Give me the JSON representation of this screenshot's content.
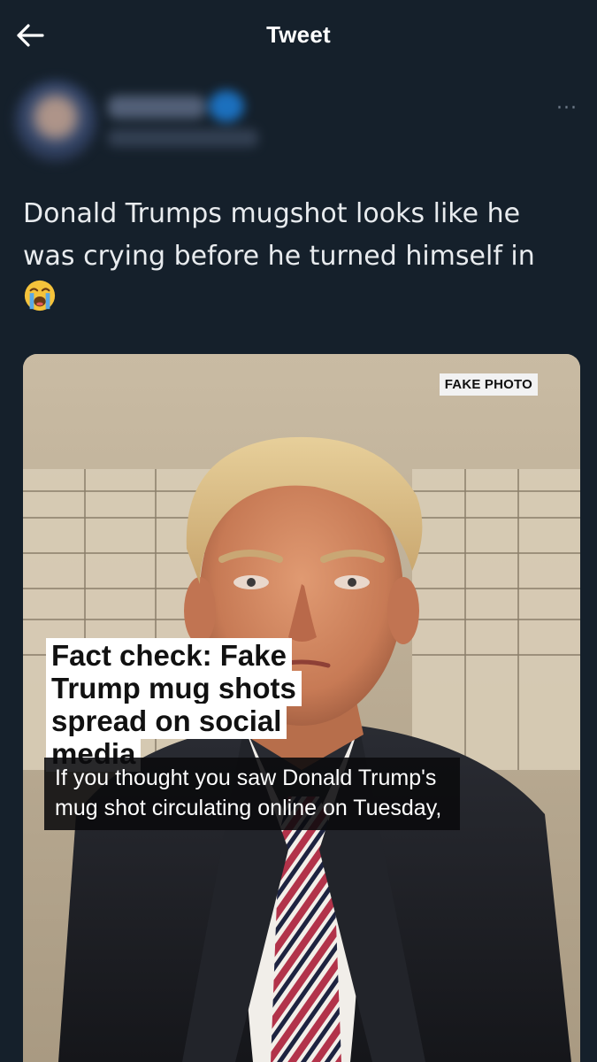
{
  "header": {
    "title": "Tweet",
    "back_icon": "arrow-left-icon"
  },
  "author": {
    "blurred": true
  },
  "more_icon_text": "···",
  "tweet": {
    "text": "Donald Trumps mugshot looks like he was crying before he turned himself in",
    "emoji": "loudly-crying-face"
  },
  "media": {
    "badge": "FAKE PHOTO",
    "headline_lines": [
      "Fact check: Fake",
      "Trump mug shots",
      "spread on social media"
    ],
    "caption": "If you thought you saw Donald Trump's mug shot circulating online on Tuesday,"
  },
  "colors": {
    "background": "#15202b",
    "text": "#ffffff",
    "muted": "#6e7a89"
  }
}
